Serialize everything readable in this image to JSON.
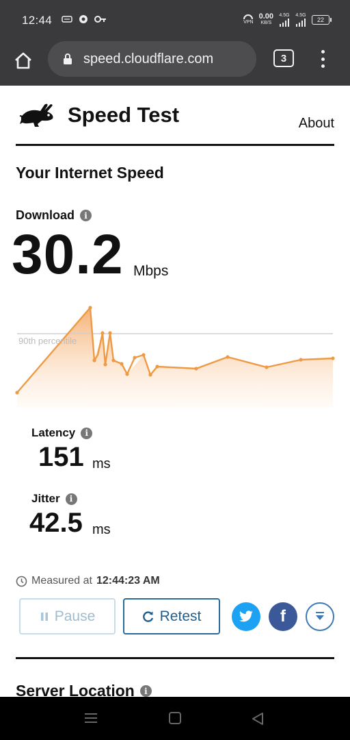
{
  "status_bar": {
    "time": "12:44",
    "net_speed_value": "0.00",
    "net_speed_unit": "KB/S",
    "vpn_label": "VPN",
    "signal1_label": "4.5G",
    "signal2_label": "4.5G",
    "battery_level": "22"
  },
  "browser": {
    "url": "speed.cloudflare.com",
    "tab_count": "3"
  },
  "site": {
    "title": "Speed Test",
    "about_link": "About"
  },
  "results": {
    "section_title": "Your Internet Speed",
    "download_label": "Download",
    "download_value": "30.2",
    "download_unit": "Mbps",
    "percentile_label": "90th percentile",
    "latency_label": "Latency",
    "latency_value": "151",
    "latency_unit": "ms",
    "jitter_label": "Jitter",
    "jitter_value": "42.5",
    "jitter_unit": "ms",
    "measured_prefix": "Measured at",
    "measured_time": "12:44:23 AM"
  },
  "actions": {
    "pause_label": "Pause",
    "retest_label": "Retest"
  },
  "server": {
    "section_title": "Server Location"
  },
  "colors": {
    "chart_line": "#f0a04b",
    "chart_fill": "#f7b57a",
    "twitter": "#1da1f2",
    "facebook": "#3b5998",
    "accent": "#1f5f8e"
  }
}
